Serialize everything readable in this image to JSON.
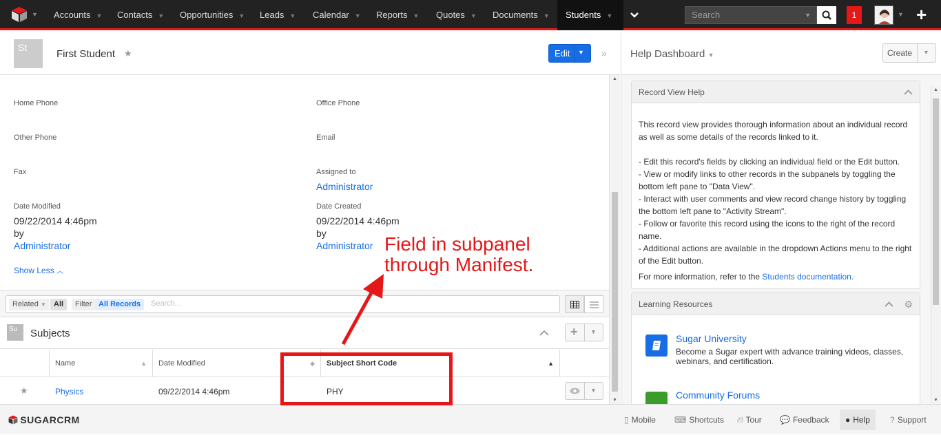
{
  "nav": {
    "items": [
      {
        "label": "Accounts"
      },
      {
        "label": "Contacts"
      },
      {
        "label": "Opportunities"
      },
      {
        "label": "Leads"
      },
      {
        "label": "Calendar"
      },
      {
        "label": "Reports"
      },
      {
        "label": "Quotes"
      },
      {
        "label": "Documents"
      },
      {
        "label": "Students"
      }
    ],
    "search_placeholder": "Search",
    "notifications": "1"
  },
  "record": {
    "avatar": "St",
    "name": "First Student",
    "edit_label": "Edit",
    "fields": {
      "home_phone_label": "Home Phone",
      "office_phone_label": "Office Phone",
      "other_phone_label": "Other Phone",
      "email_label": "Email",
      "fax_label": "Fax",
      "assigned_label": "Assigned to",
      "assigned_value": "Administrator",
      "date_modified_label": "Date Modified",
      "date_modified_value": "09/22/2014 4:46pm",
      "date_modified_by": "by",
      "date_modified_user": "Administrator",
      "date_created_label": "Date Created",
      "date_created_value": "09/22/2014 4:46pm",
      "date_created_by": "by",
      "date_created_user": "Administrator"
    },
    "show_less": "Show Less"
  },
  "filter": {
    "related": "Related",
    "all": "All",
    "filter": "Filter",
    "all_records": "All Records",
    "search_placeholder": "Search..."
  },
  "subpanel": {
    "icon": "Su",
    "title": "Subjects",
    "columns": [
      "Name",
      "Date Modified",
      "Subject Short Code"
    ],
    "rows": [
      {
        "name": "Physics",
        "date_modified": "09/22/2014 4:46pm",
        "short_code": "PHY"
      }
    ]
  },
  "dashboard": {
    "title": "Help Dashboard",
    "create_label": "Create",
    "record_help_title": "Record View Help",
    "help_intro": "This record view provides thorough information about an individual record as well as some details of the records linked to it.",
    "help_items": [
      "- Edit this record's fields by clicking an individual field or the Edit button.",
      "- View or modify links to other records in the subpanels by toggling the bottom left pane to \"Data View\".",
      "- Interact with user comments and view record change history by toggling the bottom left pane to \"Activity Stream\".",
      "- Follow or favorite this record using the icons to the right of the record name.",
      "- Additional actions are available in the dropdown Actions menu to the right of the Edit button."
    ],
    "more_info_prefix": "For more information, refer to the ",
    "more_info_link": "Students documentation.",
    "learning_title": "Learning Resources",
    "sugar_university_title": "Sugar University",
    "sugar_university_desc": "Become a Sugar expert with advance training videos, classes, webinars, and certification.",
    "community_title": "Community Forums"
  },
  "footer": {
    "logo": "SUGARCRM",
    "items": [
      "Mobile",
      "Shortcuts",
      "Tour",
      "Feedback",
      "Help",
      "Support"
    ]
  },
  "annotation": {
    "line1": "Field in subpanel",
    "line2": "through Manifest."
  },
  "colors": {
    "accent_red": "#e61718",
    "link_blue": "#176de5",
    "nav_bg": "#222222"
  }
}
